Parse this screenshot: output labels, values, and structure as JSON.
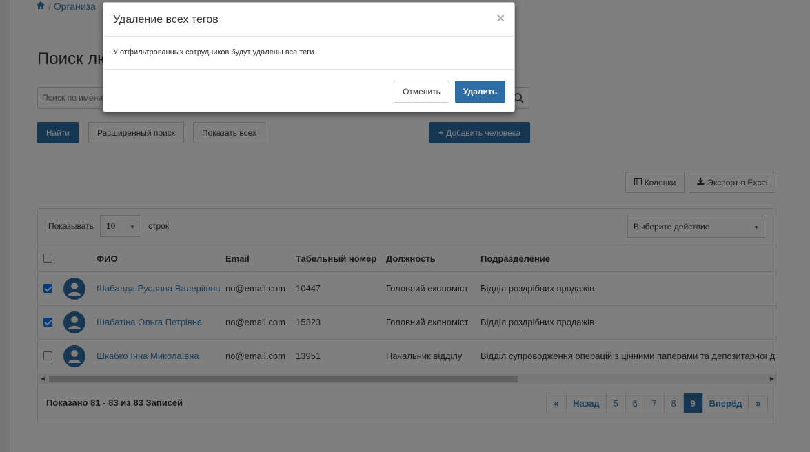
{
  "breadcrumb": {
    "item": "Организа",
    "separator": "/"
  },
  "page": {
    "title": "Поиск лю"
  },
  "search": {
    "placeholder": "Поиск по имени"
  },
  "buttons": {
    "find": "Найти",
    "advanced": "Расширенный поиск",
    "show_all": "Показать всех",
    "add_person": "Добавить человека",
    "columns": "Колонки",
    "export": "Экспорт в Excel"
  },
  "table_controls": {
    "show_label": "Показывать",
    "page_size": "10",
    "rows_label": "строк",
    "action_select": "Выберите действие"
  },
  "table": {
    "headers": [
      "ФИО",
      "Email",
      "Табельный номер",
      "Должность",
      "Подразделение"
    ],
    "rows": [
      {
        "checked": true,
        "name": "Шабалда Руслана Валеріївна",
        "email": "no@email.com",
        "number": "10447",
        "position": "Головний економіст",
        "department": "Відділ роздрібних продажів"
      },
      {
        "checked": true,
        "name": "Шабатіна Ольга Петрівна",
        "email": "no@email.com",
        "number": "15323",
        "position": "Головний економіст",
        "department": "Відділ роздрібних продажів"
      },
      {
        "checked": false,
        "name": "Шкабко Інна Миколаївна",
        "email": "no@email.com",
        "number": "13951",
        "position": "Начальник відділу",
        "department": "Відділ супроводження операцій з цінними паперами та депозитарної д"
      }
    ]
  },
  "info": {
    "prefix": "Показано",
    "from": "81",
    "dash": "-",
    "to": "83",
    "of": "из",
    "total": "83",
    "suffix": "Записей"
  },
  "pagination": {
    "first": "«",
    "prev": "Назад",
    "pages": [
      "5",
      "6",
      "7",
      "8",
      "9"
    ],
    "active": "9",
    "next": "Вперёд",
    "last": "»"
  },
  "modal": {
    "title": "Удаление всех тегов",
    "close": "×",
    "body": "У отфильтрованных сотрудников будут удалены все теги.",
    "cancel": "Отменить",
    "confirm": "Удалить"
  },
  "colors": {
    "primary": "#2e6da4",
    "link": "#337ab7",
    "checkbox": "#0075ff"
  }
}
